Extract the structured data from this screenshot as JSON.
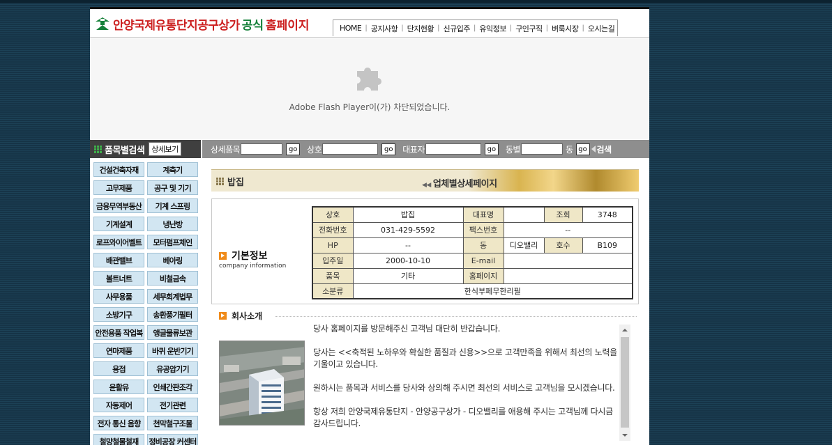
{
  "header": {
    "logo_text": "안양국제유통단지공구상가",
    "logo_text2": "공식",
    "logo_text3": "홈페이지",
    "nav": [
      "HOME",
      "공지사항",
      "단지현황",
      "신규입주",
      "유익정보",
      "구인구직",
      "벼룩시장",
      "오시는길"
    ]
  },
  "flash": {
    "message": "Adobe Flash Player이(가) 차단되었습니다."
  },
  "sidebar": {
    "title": "품목별검색",
    "detail_button": "상세보기",
    "categories": [
      "건설건축자재",
      "계측기",
      "고무제품",
      "공구 및 기기",
      "금융무역부동산",
      "기계 스프링",
      "기계설계",
      "냉난방",
      "로프와이어벨트",
      "모터펌프체인",
      "배관밸브",
      "베아링",
      "볼트너트",
      "비철금속",
      "사무용품",
      "세무회계법무",
      "소방기구",
      "송환풍기필터",
      "안전용품 작업복",
      "앵글물류보관",
      "연마제품",
      "바퀴 운반기기",
      "용접",
      "유공압기기",
      "윤활유",
      "인쇄간판조각",
      "자동제어",
      "전기관련",
      "전자 통신 음향",
      "천막철구조물",
      "철망철물철재",
      "정비공장 커센터"
    ]
  },
  "searchbar": {
    "field1_label": "상세품목",
    "field2_label": "상호",
    "field3_label": "대표자",
    "field4_label": "동별",
    "field4_suffix": "동",
    "go_label": "go",
    "search_label": "검색"
  },
  "company": {
    "name": "밥집",
    "detail_page_label": "업체별상세페이지",
    "basic_title": "기본정보",
    "basic_sub": "company information",
    "labels": {
      "name": "상호",
      "ceo": "대표명",
      "views": "조회",
      "tel": "전화번호",
      "fax": "팩스번호",
      "hp": "HP",
      "dong": "동",
      "ho": "호수",
      "date": "입주일",
      "email": "E-mail",
      "item": "품목",
      "homepage": "홈페이지",
      "subcat": "소분류"
    },
    "values": {
      "name": "밥집",
      "ceo": "",
      "views": "3748",
      "tel": "031-429-5592",
      "fax": "--",
      "hp": "--",
      "dong": "디오밸리",
      "ho": "B109",
      "date": "2000-10-10",
      "email": "",
      "item": "기타",
      "homepage": "",
      "subcat": "한식부페무한리필"
    },
    "intro_title": "회사소개",
    "intro_paragraphs": [
      "당사 홈페이지를 방문해주신 고객님 대단히 반갑습니다.",
      "당사는 <<축적된 노하우와 확실한 품질과 신용>>으로 고객만족을 위해서 최선의 노력을 기울이고 있습니다.",
      "원하시는 품목과 서비스를 당사와 상의해 주시면 최선의 서비스로 고객님을 모시겠습니다.",
      "항상 저희 안양국제유통단지 - 안양공구상가 - 디오밸리를 애용해 주시는 고객님께 다시금 감사드립니다."
    ]
  },
  "colors": {
    "background": "#163447",
    "logo_red": "#cc1f1f",
    "logo_green": "#16813a",
    "category_bg": "#d2e6f2",
    "table_header_bg": "#efe7c7",
    "section_icon": "#f08b1a"
  }
}
